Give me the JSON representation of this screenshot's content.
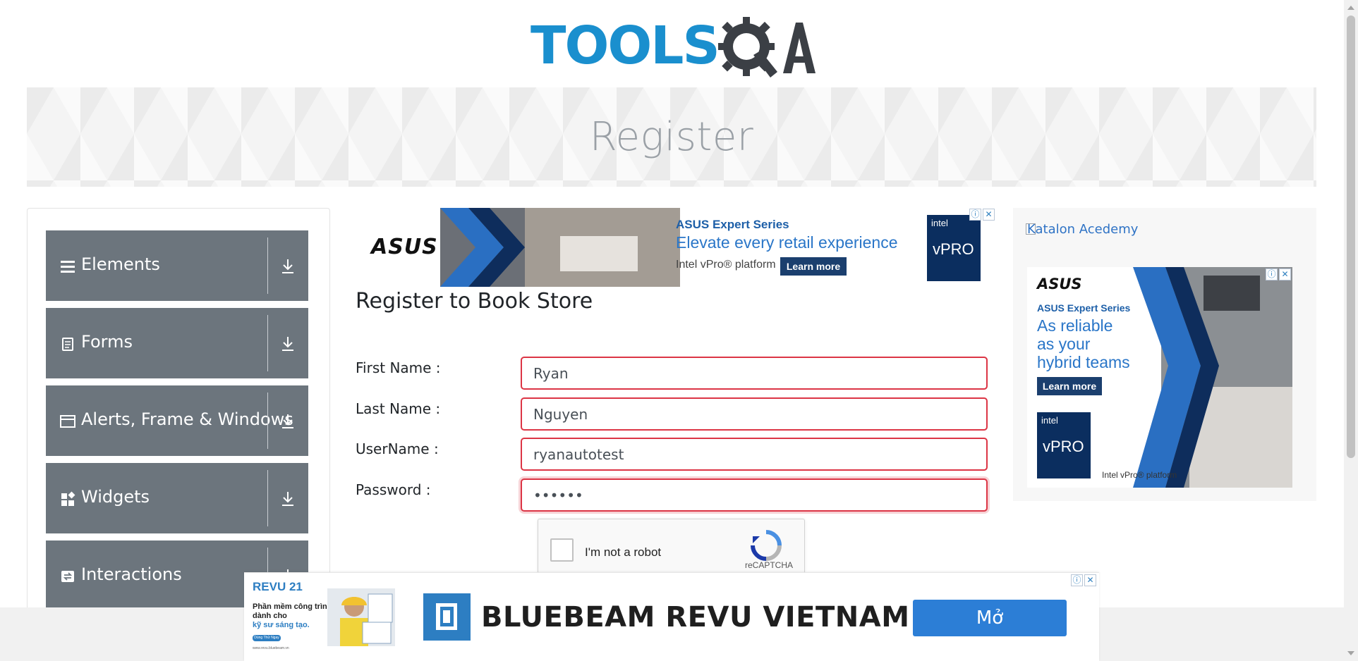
{
  "logo": {
    "text": "TOOLS",
    "qa": "QA"
  },
  "banner": {
    "title": "Register"
  },
  "sidebar": {
    "groups": [
      {
        "label": "Elements",
        "icon": "menu-lines-icon"
      },
      {
        "label": "Forms",
        "icon": "document-icon"
      },
      {
        "label": "Alerts, Frame & Windows",
        "icon": "window-icon"
      },
      {
        "label": "Widgets",
        "icon": "widgets-icon"
      },
      {
        "label": "Interactions",
        "icon": "interactions-icon"
      }
    ]
  },
  "ad_top": {
    "brand": "ASUS",
    "series": "ASUS Expert Series",
    "headline": "Elevate every retail experience",
    "platform": "Intel vPro® platform",
    "cta": "Learn more",
    "badge_top": "intel",
    "badge_main": "vPRO"
  },
  "form": {
    "title": "Register to Book Store",
    "first_name_label": "First Name :",
    "first_name_value": "Ryan",
    "last_name_label": "Last Name :",
    "last_name_value": "Nguyen",
    "username_label": "UserName :",
    "username_value": "ryanautotest",
    "password_label": "Password :",
    "password_value": "••••••"
  },
  "captcha": {
    "label": "I'm not a robot",
    "brand": "reCAPTCHA"
  },
  "ad_right": {
    "alt_text": "Katalon Acedemy",
    "brand": "ASUS",
    "series": "ASUS Expert Series",
    "headline_1": "As reliable",
    "headline_2": "as your",
    "headline_3": "hybrid teams",
    "cta": "Learn more",
    "badge_top": "intel",
    "badge_main": "vPRO",
    "platform": "Intel vPro® platform"
  },
  "ad_bottom": {
    "product": "REVU 21",
    "tagline_1": "Phần mềm công trình",
    "tagline_2": "dành cho",
    "tagline_3": "kỹ sư sáng tạo.",
    "small_btn": "Dùng Thử Ngay",
    "site": "www.revu.bluebeam.vn",
    "brand": "BLUEBEAM REVU VIETNAM",
    "cta": "Mở"
  },
  "colors": {
    "accent": "#1a8fce",
    "sidebar": "#6c757d",
    "error": "#dc3545",
    "link": "#2f73c5"
  }
}
